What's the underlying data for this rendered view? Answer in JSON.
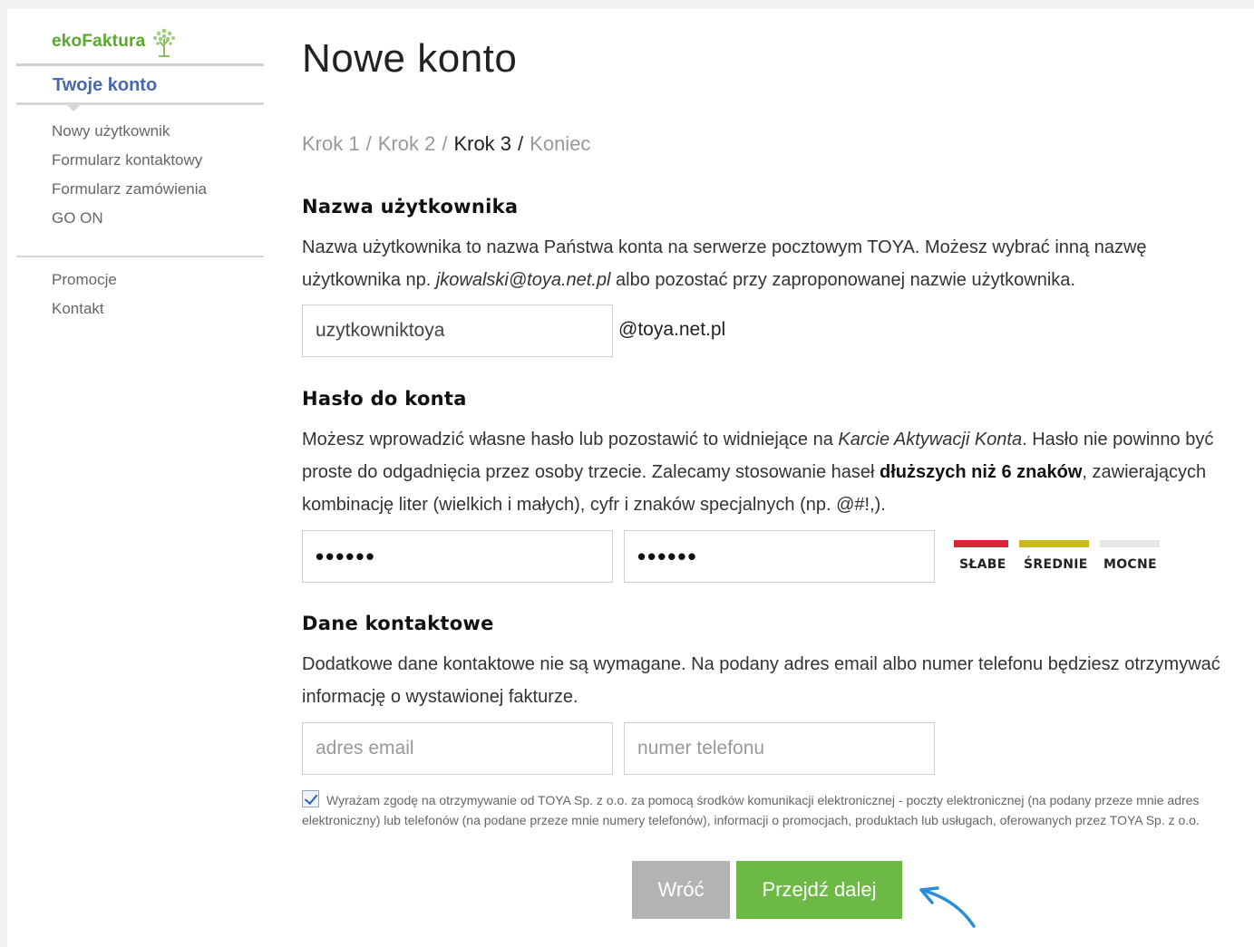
{
  "sidebar": {
    "logo": "ekoFaktura",
    "title": "Twoje konto",
    "nav": [
      "Nowy użytkownik",
      "Formularz kontaktowy",
      "Formularz zamówienia",
      "GO ON"
    ],
    "nav2": [
      "Promocje",
      "Kontakt"
    ]
  },
  "main": {
    "title": "Nowe konto",
    "steps": {
      "step1": "Krok 1",
      "step2": "Krok 2",
      "step3": "Krok 3",
      "end": "Koniec",
      "separator": "/"
    },
    "username": {
      "heading": "Nazwa użytkownika",
      "text_before": "Nazwa użytkownika to nazwa Państwa konta na serwerze pocztowym TOYA. Możesz wybrać inną nazwę użytkownika np. ",
      "example": "jkowalski@toya.net.pl",
      "text_after": " albo pozostać przy zaproponowanej nazwie użytkownika.",
      "value": "uzytkowniktoya",
      "domain": "@toya.net.pl"
    },
    "password": {
      "heading": "Hasło do konta",
      "text_1": "Możesz wprowadzić własne hasło lub pozostawić to widniejące na ",
      "text_italic": "Karcie Aktywacji Konta",
      "text_2": ". Hasło nie powinno być proste do odgadnięcia przez osoby trzecie. Zalecamy stosowanie haseł ",
      "text_bold": "dłuższych niż 6 znaków",
      "text_3": ", zawierających kombinację liter (wielkich i małych), cyfr i znaków specjalnych (np. @#!,).",
      "value1": "••••••",
      "value2": "••••••",
      "strength": {
        "weak": "SŁABE",
        "medium": "ŚREDNIE",
        "strong": "MOCNE",
        "colors": {
          "weak": "#d9283a",
          "medium": "#c9b91b",
          "strong": "#e6e6e6"
        }
      }
    },
    "contact": {
      "heading": "Dane kontaktowe",
      "text": "Dodatkowe dane kontaktowe nie są wymagane. Na podany adres email albo numer telefonu będziesz otrzymywać informację o wystawionej fakturze.",
      "email_placeholder": "adres email",
      "phone_placeholder": "numer telefonu"
    },
    "consent": {
      "checked": true,
      "text": "Wyrażam zgodę na otrzymywanie od TOYA Sp. z o.o. za pomocą środków komunikacji elektronicznej - poczty elektronicznej (na podany przeze mnie adres elektroniczny) lub telefonów (na podane przeze mnie numery telefonów), informacji o promocjach, produktach lub usługach, oferowanych przez TOYA Sp. z o.o."
    },
    "buttons": {
      "back": "Wróć",
      "next": "Przejdź dalej"
    }
  },
  "colors": {
    "accent_green": "#6cba45",
    "link_blue": "#4a68b0",
    "arrow_blue": "#2a8fd6"
  }
}
